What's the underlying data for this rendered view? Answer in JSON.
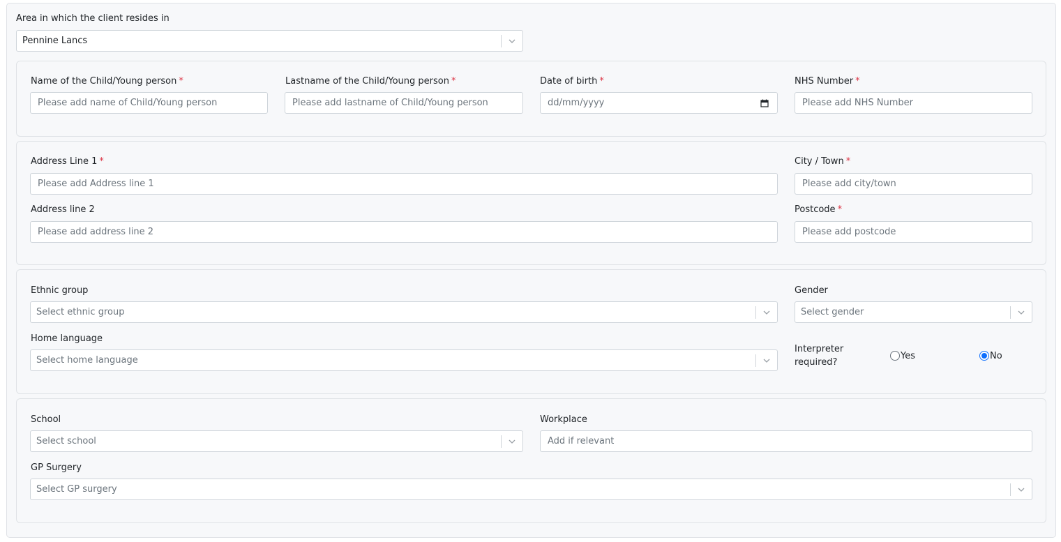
{
  "area": {
    "label": "Area in which the client resides in",
    "selected": "Pennine Lancs"
  },
  "personal": {
    "first_name": {
      "label": "Name of the Child/Young person",
      "required": "*",
      "placeholder": "Please add name of Child/Young person"
    },
    "last_name": {
      "label": "Lastname of the Child/Young person",
      "required": "*",
      "placeholder": "Please add lastname of Child/Young person"
    },
    "dob": {
      "label": "Date of birth",
      "required": "*",
      "placeholder": "dd/mm/yyyy"
    },
    "nhs": {
      "label": "NHS Number",
      "required": "*",
      "placeholder": "Please add NHS Number"
    }
  },
  "address": {
    "line1": {
      "label": "Address Line 1",
      "required": "*",
      "placeholder": "Please add Address line 1"
    },
    "city": {
      "label": "City / Town",
      "required": "*",
      "placeholder": "Please add city/town"
    },
    "line2": {
      "label": "Address line 2",
      "placeholder": "Please add address line 2"
    },
    "postcode": {
      "label": "Postcode",
      "required": "*",
      "placeholder": "Please add postcode"
    }
  },
  "demographics": {
    "ethnic": {
      "label": "Ethnic group",
      "placeholder": "Select ethnic group"
    },
    "gender": {
      "label": "Gender",
      "placeholder": "Select gender"
    },
    "language": {
      "label": "Home language",
      "placeholder": "Select home language"
    },
    "interpreter": {
      "label_line1": "Interpreter",
      "label_line2": "required?",
      "yes_label": "Yes",
      "no_label": "No",
      "selected": "No"
    }
  },
  "services": {
    "school": {
      "label": "School",
      "placeholder": "Select school"
    },
    "workplace": {
      "label": "Workplace",
      "placeholder": "Add if relevant"
    },
    "gp": {
      "label": "GP Surgery",
      "placeholder": "Select GP surgery"
    }
  },
  "colors": {
    "required": "#dc3545",
    "accent": "#0d6efd",
    "panel_bg": "#f7f8fa",
    "border": "#dfe2e6"
  }
}
